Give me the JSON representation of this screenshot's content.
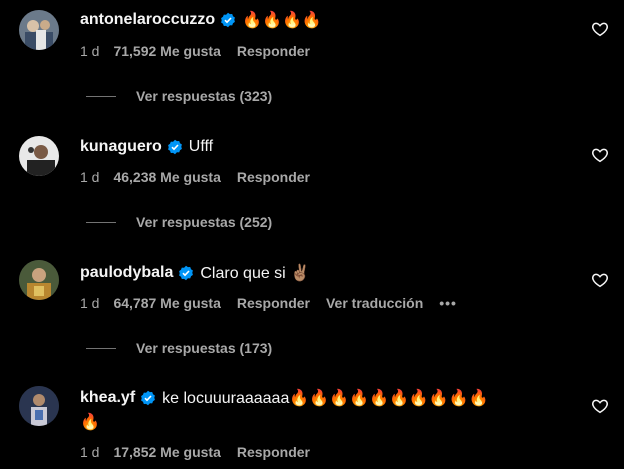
{
  "icons": {
    "verified": "verified-badge-icon",
    "like": "heart-outline-icon",
    "more": "more-dots-icon"
  },
  "colors": {
    "background": "#000000",
    "verified": "#0095f6",
    "muted": "#a8a8a8"
  },
  "comments": [
    {
      "username": "antonelaroccuzzo",
      "text": "🔥🔥🔥🔥",
      "text_cont": "",
      "time": "1 d",
      "likes": "71,592 Me gusta",
      "reply": "Responder",
      "translate": "",
      "replies": "Ver respuestas (323)"
    },
    {
      "username": "kunaguero",
      "text": "Ufff",
      "text_cont": "",
      "time": "1 d",
      "likes": "46,238 Me gusta",
      "reply": "Responder",
      "translate": "",
      "replies": "Ver respuestas (252)"
    },
    {
      "username": "paulodybala",
      "text": "Claro que si ✌🏽",
      "text_cont": "",
      "time": "1 d",
      "likes": "64,787 Me gusta",
      "reply": "Responder",
      "translate": "Ver traducción",
      "more": "•••",
      "replies": "Ver respuestas (173)"
    },
    {
      "username": "khea.yf",
      "text": "ke locuuuraaaaaa🔥🔥🔥🔥🔥🔥🔥🔥🔥🔥",
      "text_cont": "🔥",
      "time": "1 d",
      "likes": "17,852 Me gusta",
      "reply": "Responder",
      "translate": "",
      "replies": ""
    }
  ]
}
